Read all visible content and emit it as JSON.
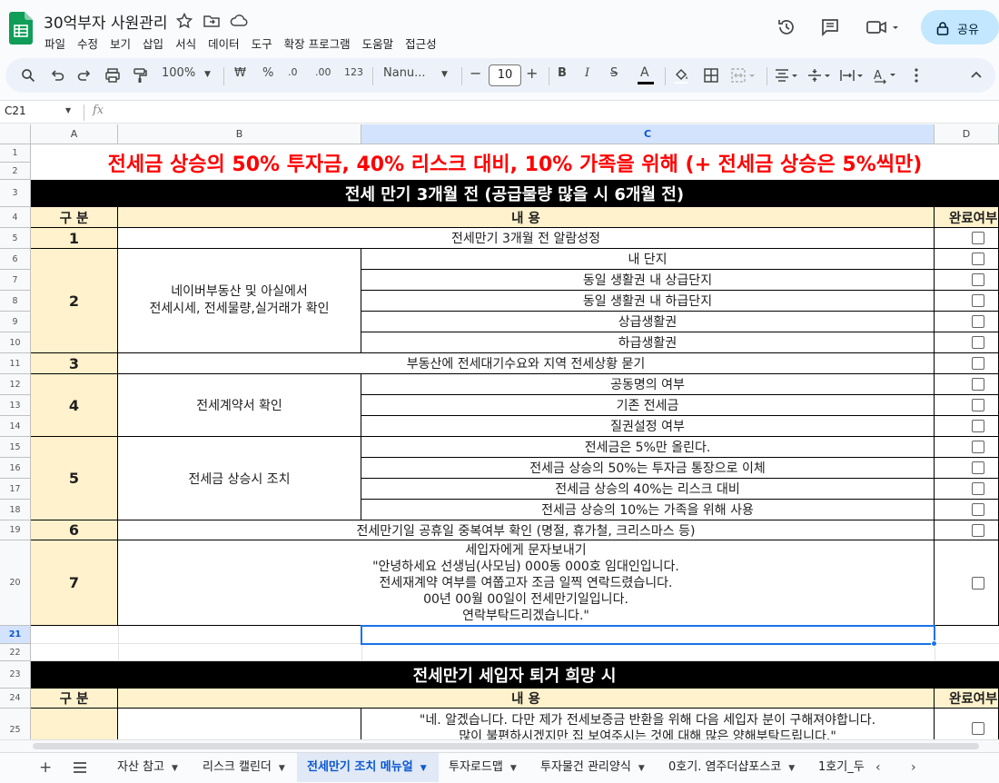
{
  "app": {
    "doc_title": "30억부자 사원관리",
    "menu": [
      "파일",
      "수정",
      "보기",
      "삽입",
      "서식",
      "데이터",
      "도구",
      "확장 프로그램",
      "도움말",
      "접근성"
    ],
    "share_label": "공유"
  },
  "toolbar": {
    "zoom": "100%",
    "currency": "₩",
    "percent": "%",
    "dec_decrease": ".0",
    "dec_increase": ".00",
    "number_format": "123",
    "font": "Nanu...",
    "font_size": "10"
  },
  "formula_bar": {
    "cell_ref": "C21",
    "fx": "fx"
  },
  "columns": [
    "A",
    "B",
    "C",
    "D"
  ],
  "rows": [
    "1",
    "2",
    "3",
    "4",
    "5",
    "6",
    "7",
    "8",
    "9",
    "10",
    "11",
    "12",
    "13",
    "14",
    "15",
    "16",
    "17",
    "18",
    "19",
    "20",
    "21",
    "22",
    "23",
    "24",
    "25"
  ],
  "sheet": {
    "banner": "전세금 상승의 50% 투자금, 40% 리스크 대비, 10% 가족을 위해 (+ 전세금 상승은 5%씩만)",
    "section1_title": "전세 만기 3개월 전 (공급물량 많을 시 6개월 전)",
    "col_gubun": "구 분",
    "col_content": "내 용",
    "col_done": "완료여부",
    "item1_num": "1",
    "item1_text": "전세만기 3개월 전 알람성정",
    "item2_num": "2",
    "item2_label": "네이버부동산 및 아실에서\n전세시세, 전세물량,실거래가 확인",
    "item2_subs": [
      "내 단지",
      "동일 생활권 내 상급단지",
      "동일 생활권 내 하급단지",
      "상급생활권",
      "하급생활권"
    ],
    "item3_num": "3",
    "item3_text": "부동산에 전세대기수요와 지역 전세상황 묻기",
    "item4_num": "4",
    "item4_label": "전세계약서 확인",
    "item4_subs": [
      "공동명의 여부",
      "기존 전세금",
      "질권설정 여부"
    ],
    "item5_num": "5",
    "item5_label": "전세금 상승시 조치",
    "item5_subs": [
      "전세금은 5%만 올린다.",
      "전세금 상승의 50%는 투자금 통장으로 이체",
      "전세금 상승의 40%는 리스크 대비",
      "전세금 상승의 10%는 가족을 위해 사용"
    ],
    "item6_num": "6",
    "item6_text": "전세만기일 공휴일 중복여부 확인 (명절, 휴가철, 크리스마스 등)",
    "item7_num": "7",
    "item7_text": "세입자에게 문자보내기\n\"안녕하세요 선생님(사모님) 000동 000호 임대인입니다.\n전세재계약 여부를 여쭙고자 조금 일찍 연락드렸습니다.\n00년 00월 00일이 전세만기일입니다.\n연락부탁드리겠습니다.\"",
    "section2_title": "전세만기 세입자 퇴거 희망 시",
    "item8_text": "\"네. 알겠습니다. 다만 제가 전세보증금 반환을 위해 다음 세입자 분이 구해져야합니다.\n많이 불편하시겠지만 집 보여주시는 것에 대해 많은 양해부탁드립니다.\""
  },
  "tabs": [
    "자산 참고",
    "리스크 캘린더",
    "전세만기 조치 메뉴얼",
    "투자로드맵",
    "투자물건 관리양식",
    "0호기. 염주더샵포스코",
    "1호기_두"
  ],
  "active_tab": "전세만기 조치 메뉴얼",
  "colors": {
    "accent": "#0b57d0",
    "banner_red": "#ff0000",
    "header_yellow": "#fff2cc",
    "share_blue": "#c2e7ff"
  }
}
